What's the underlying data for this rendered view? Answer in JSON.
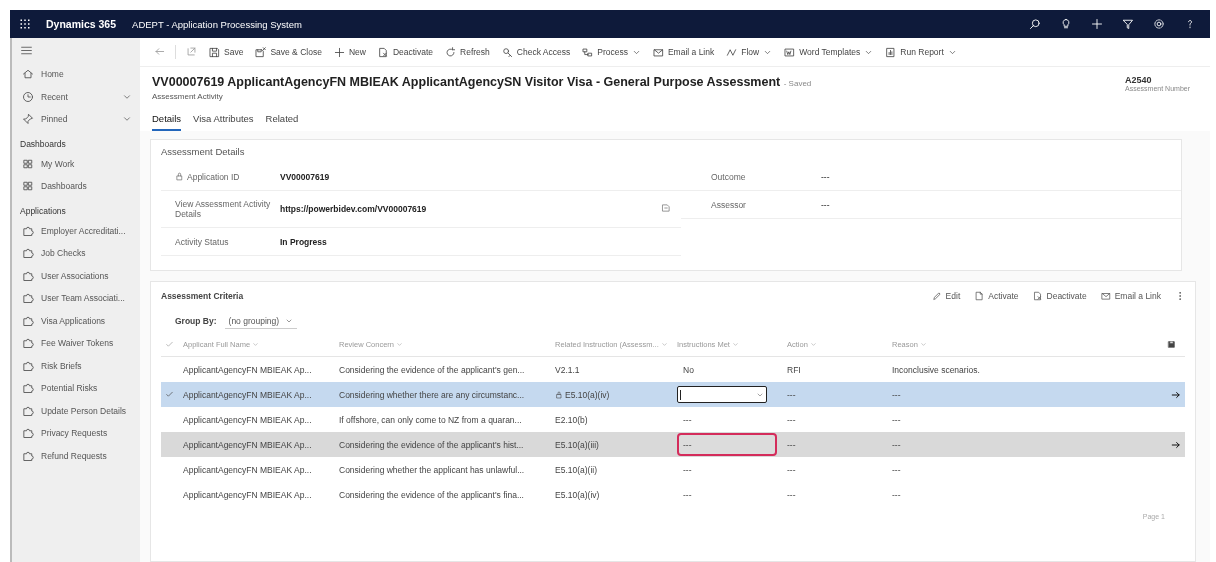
{
  "app": {
    "name": "Dynamics 365",
    "title": "ADEPT - Application Processing System"
  },
  "sidebar": {
    "nav": [
      {
        "label": "Home",
        "expandable": false
      },
      {
        "label": "Recent",
        "expandable": true
      },
      {
        "label": "Pinned",
        "expandable": true
      }
    ],
    "groups": [
      {
        "heading": "Dashboards",
        "items": [
          "My Work",
          "Dashboards"
        ]
      },
      {
        "heading": "Applications",
        "items": [
          "Employer Accreditati...",
          "Job Checks",
          "User Associations",
          "User Team Associati...",
          "Visa Applications",
          "Fee Waiver Tokens",
          "Risk Briefs",
          "Potential Risks",
          "Update Person Details",
          "Privacy Requests",
          "Refund Requests"
        ]
      }
    ]
  },
  "commands": [
    {
      "label": "Save",
      "dropdown": false
    },
    {
      "label": "Save & Close",
      "dropdown": false
    },
    {
      "label": "New",
      "dropdown": false
    },
    {
      "label": "Deactivate",
      "dropdown": false
    },
    {
      "label": "Refresh",
      "dropdown": false
    },
    {
      "label": "Check Access",
      "dropdown": false
    },
    {
      "label": "Process",
      "dropdown": true
    },
    {
      "label": "Email a Link",
      "dropdown": false
    },
    {
      "label": "Flow",
      "dropdown": true
    },
    {
      "label": "Word Templates",
      "dropdown": true
    },
    {
      "label": "Run Report",
      "dropdown": true
    }
  ],
  "record": {
    "title": "VV00007619 ApplicantAgencyFN MBIEAK ApplicantAgencySN Visitor Visa - General Purpose Assessment",
    "save_status": "- Saved",
    "entity": "Assessment Activity",
    "number": "A2540",
    "number_label": "Assessment Number"
  },
  "tabs": [
    {
      "label": "Details",
      "selected": true
    },
    {
      "label": "Visa Attributes",
      "selected": false
    },
    {
      "label": "Related",
      "selected": false
    }
  ],
  "details": {
    "title": "Assessment Details",
    "left_fields": [
      {
        "kind": "text",
        "label": "Application ID",
        "value": "VV00007619",
        "locked": true
      },
      {
        "kind": "url",
        "label": "View Assessment Activity Details",
        "value": "https://powerbidev.com/VV00007619",
        "locked": false
      },
      {
        "kind": "text",
        "label": "Activity Status",
        "value": "In Progress",
        "locked": false
      }
    ],
    "right_fields": [
      {
        "label": "Outcome",
        "value": "---"
      },
      {
        "label": "Assessor",
        "value": "---"
      }
    ]
  },
  "criteria": {
    "title": "Assessment Criteria",
    "commands": [
      "Edit",
      "Activate",
      "Deactivate",
      "Email a Link"
    ],
    "group_by_label": "Group By:",
    "group_by_value": "(no grouping)",
    "columns": [
      "Applicant Full Name",
      "Review Concern",
      "Related Instruction (Assessm...",
      "Instructions Met",
      "Action",
      "Reason"
    ],
    "rows": [
      {
        "selected": false,
        "highlighted": false,
        "locked": false,
        "editing": false,
        "focused": false,
        "applicant": "ApplicantAgencyFN MBIEAK Ap...",
        "concern": "Considering the evidence of the applicant's gen...",
        "instruction": "V2.1.1",
        "instructions_met": "No",
        "action": "RFI",
        "reason": "Inconclusive scenarios."
      },
      {
        "selected": true,
        "highlighted": false,
        "locked": true,
        "editing": true,
        "focused": false,
        "applicant": "ApplicantAgencyFN MBIEAK Ap...",
        "concern": "Considering whether there are any circumstanc...",
        "instruction": "E5.10(a)(iv)",
        "action": "---",
        "reason": "---"
      },
      {
        "selected": false,
        "highlighted": false,
        "locked": false,
        "editing": false,
        "focused": false,
        "applicant": "ApplicantAgencyFN MBIEAK Ap...",
        "concern": "If offshore, can only come to NZ from a quaran...",
        "instruction": "E2.10(b)",
        "instructions_met": "---",
        "action": "---",
        "reason": "---"
      },
      {
        "selected": false,
        "highlighted": true,
        "locked": false,
        "editing": false,
        "focused": true,
        "applicant": "ApplicantAgencyFN MBIEAK Ap...",
        "concern": "Considering the evidence of the applicant's hist...",
        "instruction": "E5.10(a)(iii)",
        "instructions_met": "---",
        "action": "---",
        "reason": "---"
      },
      {
        "selected": false,
        "highlighted": false,
        "locked": false,
        "editing": false,
        "focused": false,
        "applicant": "ApplicantAgencyFN MBIEAK Ap...",
        "concern": "Considering whether the applicant has unlawful...",
        "instruction": "E5.10(a)(ii)",
        "instructions_met": "---",
        "action": "---",
        "reason": "---"
      },
      {
        "selected": false,
        "highlighted": false,
        "locked": false,
        "editing": false,
        "focused": false,
        "applicant": "ApplicantAgencyFN MBIEAK Ap...",
        "concern": "Considering the evidence of the applicant's fina...",
        "instruction": "E5.10(a)(iv)",
        "instructions_met": "---",
        "action": "---",
        "reason": "---"
      }
    ],
    "pager": "Page 1"
  }
}
